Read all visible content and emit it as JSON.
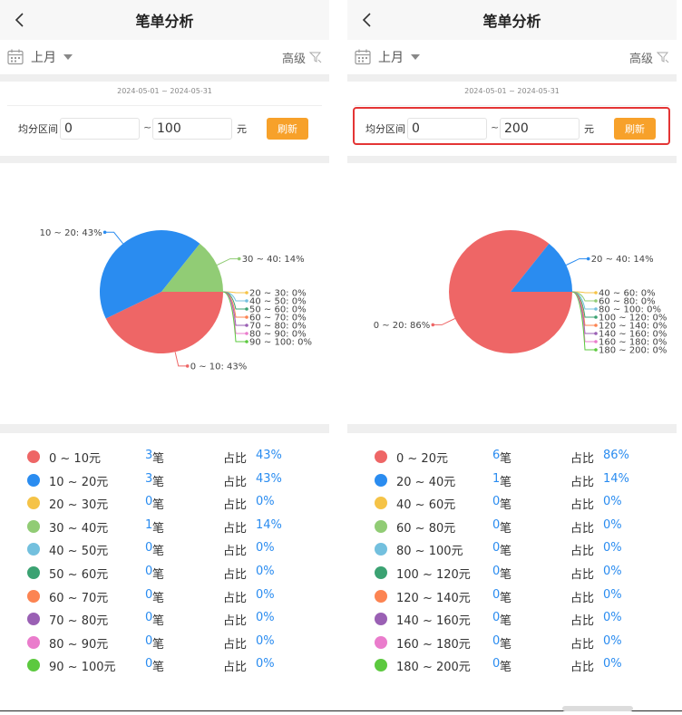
{
  "colors": {
    "palette": [
      "#ee6666",
      "#2a8cf0",
      "#f5c347",
      "#91cc75",
      "#73c0de",
      "#3ba272",
      "#fc8452",
      "#9a60b4",
      "#ea7ccc",
      "#5cc93f"
    ],
    "accent": "#f7a12a",
    "link": "#2a8cf0",
    "highlight": "#e43535"
  },
  "panels": [
    {
      "header": {
        "title": "笔单分析"
      },
      "filter": {
        "month": "上月",
        "advanced": "高级"
      },
      "date_range": "2024-05-01 ~ 2024-05-31",
      "range": {
        "label": "均分区间",
        "min": "0",
        "tilde": "~",
        "max": "100",
        "unit": "元",
        "refresh": "刷新"
      },
      "legend": {
        "count_unit": "笔",
        "pct_label": "占比",
        "items": [
          {
            "name": "0 ~ 10元",
            "count": "3",
            "pct": "43%"
          },
          {
            "name": "10 ~ 20元",
            "count": "3",
            "pct": "43%"
          },
          {
            "name": "20 ~ 30元",
            "count": "0",
            "pct": "0%"
          },
          {
            "name": "30 ~ 40元",
            "count": "1",
            "pct": "14%"
          },
          {
            "name": "40 ~ 50元",
            "count": "0",
            "pct": "0%"
          },
          {
            "name": "50 ~ 60元",
            "count": "0",
            "pct": "0%"
          },
          {
            "name": "60 ~ 70元",
            "count": "0",
            "pct": "0%"
          },
          {
            "name": "70 ~ 80元",
            "count": "0",
            "pct": "0%"
          },
          {
            "name": "80 ~ 90元",
            "count": "0",
            "pct": "0%"
          },
          {
            "name": "90 ~ 100元",
            "count": "0",
            "pct": "0%"
          }
        ]
      }
    },
    {
      "header": {
        "title": "笔单分析"
      },
      "filter": {
        "month": "上月",
        "advanced": "高级"
      },
      "date_range": "2024-05-01 ~ 2024-05-31",
      "range": {
        "label": "均分区间",
        "min": "0",
        "tilde": "~",
        "max": "200",
        "unit": "元",
        "refresh": "刷新"
      },
      "legend": {
        "count_unit": "笔",
        "pct_label": "占比",
        "items": [
          {
            "name": "0 ~ 20元",
            "count": "6",
            "pct": "86%"
          },
          {
            "name": "20 ~ 40元",
            "count": "1",
            "pct": "14%"
          },
          {
            "name": "40 ~ 60元",
            "count": "0",
            "pct": "0%"
          },
          {
            "name": "60 ~ 80元",
            "count": "0",
            "pct": "0%"
          },
          {
            "name": "80 ~ 100元",
            "count": "0",
            "pct": "0%"
          },
          {
            "name": "100 ~ 120元",
            "count": "0",
            "pct": "0%"
          },
          {
            "name": "120 ~ 140元",
            "count": "0",
            "pct": "0%"
          },
          {
            "name": "140 ~ 160元",
            "count": "0",
            "pct": "0%"
          },
          {
            "name": "160 ~ 180元",
            "count": "0",
            "pct": "0%"
          },
          {
            "name": "180 ~ 200元",
            "count": "0",
            "pct": "0%"
          }
        ]
      }
    }
  ],
  "chart_data": [
    {
      "type": "pie",
      "categories": [
        "0 ~ 10",
        "10 ~ 20",
        "20 ~ 30",
        "30 ~ 40",
        "40 ~ 50",
        "50 ~ 60",
        "60 ~ 70",
        "70 ~ 80",
        "80 ~ 90",
        "90 ~ 100"
      ],
      "values": [
        3,
        3,
        0,
        1,
        0,
        0,
        0,
        0,
        0,
        0
      ],
      "labels": [
        "0 ~ 10:  43%",
        "10 ~ 20:  43%",
        "20 ~ 30:  0%",
        "30 ~ 40:  14%",
        "40 ~ 50:  0%",
        "50 ~ 60:  0%",
        "60 ~ 70:  0%",
        "70 ~ 80:  0%",
        "80 ~ 90:  0%",
        "90 ~ 100:  0%"
      ]
    },
    {
      "type": "pie",
      "categories": [
        "0 ~ 20",
        "20 ~ 40",
        "40 ~ 60",
        "60 ~ 80",
        "80 ~ 100",
        "100 ~ 120",
        "120 ~ 140",
        "140 ~ 160",
        "160 ~ 180",
        "180 ~ 200"
      ],
      "values": [
        6,
        1,
        0,
        0,
        0,
        0,
        0,
        0,
        0,
        0
      ],
      "labels": [
        "0 ~ 20:  86%",
        "20 ~ 40:  14%",
        "40 ~ 60:  0%",
        "60 ~ 80:  0%",
        "80 ~ 100:  0%",
        "100 ~ 120:  0%",
        "120 ~ 140:  0%",
        "140 ~ 160:  0%",
        "160 ~ 180:  0%",
        "180 ~ 200:  0%"
      ]
    }
  ]
}
